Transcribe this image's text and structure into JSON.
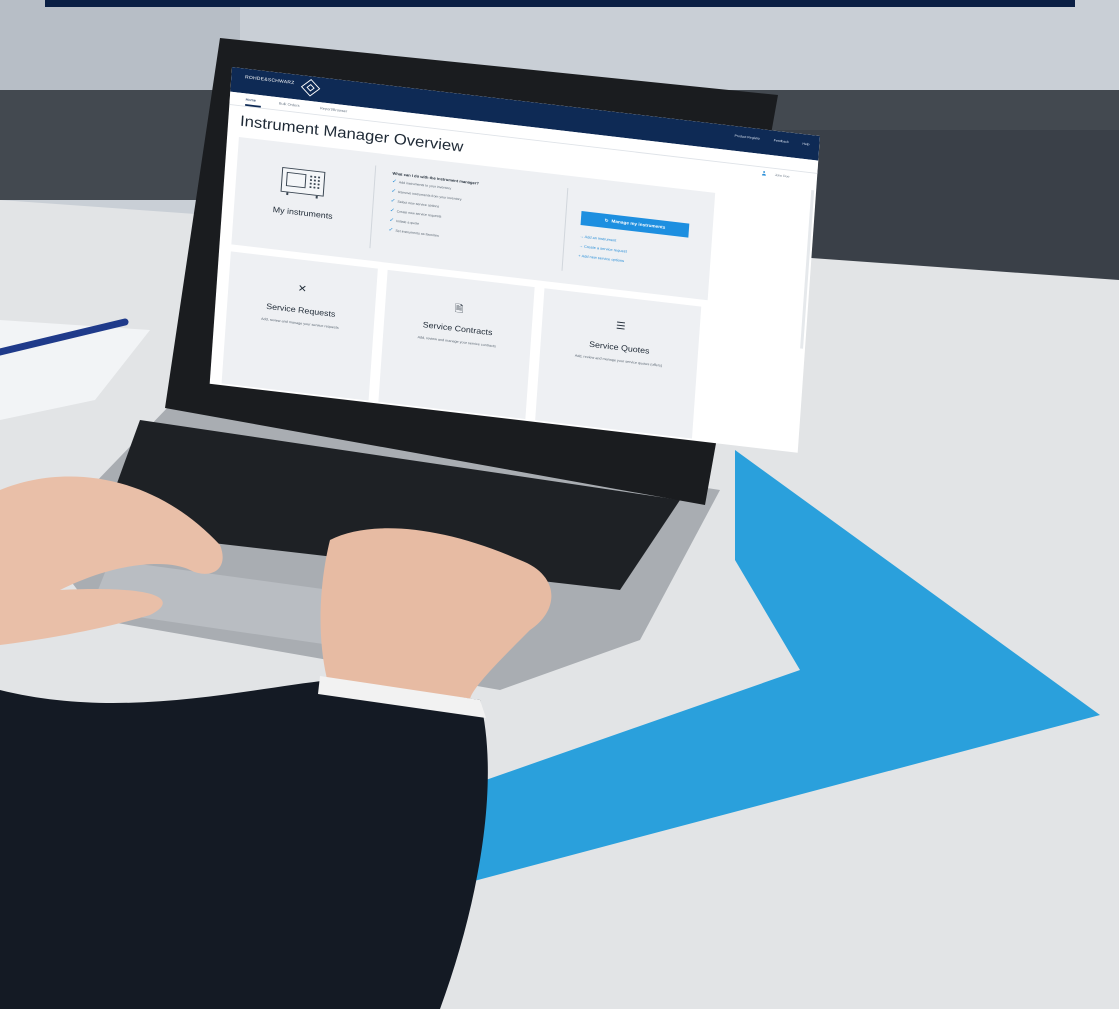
{
  "colors": {
    "header": "#0e2a55",
    "accent": "#1d8fe0",
    "panel": "#eef0f3",
    "floor_tape": "#2aa0dc"
  },
  "header": {
    "brand": "ROHDE&SCHWARZ",
    "links": [
      "Product Registry",
      "Feedback",
      "Help"
    ]
  },
  "nav": {
    "tabs": [
      "Home",
      "Bulk Orders",
      "Report/Browser"
    ]
  },
  "user": {
    "name": "John Doe"
  },
  "page": {
    "title": "Instrument Manager Overview"
  },
  "my_instruments": {
    "label": "My instruments",
    "icon": "instrument-icon",
    "what_title": "What can I do with the instrument manager?",
    "features": [
      "Add instruments to your inventory",
      "Remove instruments from your inventory",
      "Select new service options",
      "Create new service requests",
      "Initiate a quote",
      "Set instruments as favorites"
    ],
    "manage_button": "Manage my instruments",
    "links": [
      "→ Add an instrument",
      "→ Create a service request",
      "+ Add new service options"
    ]
  },
  "cards": [
    {
      "icon": "tools-icon",
      "glyph": "✕",
      "title": "Service Requests",
      "desc": "Add, review and manage your service requests"
    },
    {
      "icon": "document-icon",
      "glyph": "🗎",
      "title": "Service Contracts",
      "desc": "Add, review and manage your service contracts"
    },
    {
      "icon": "list-icon",
      "glyph": "☰",
      "title": "Service Quotes",
      "desc": "Add, review and manage your service quotes (offers)"
    }
  ]
}
